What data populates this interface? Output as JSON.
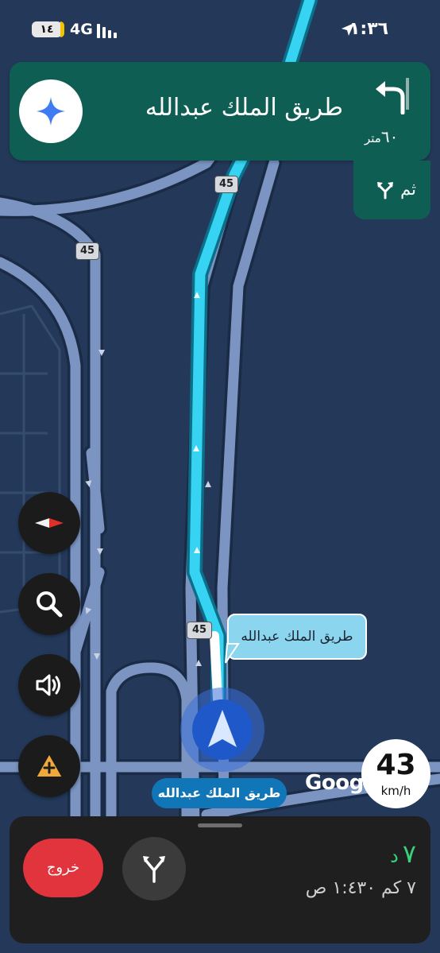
{
  "status_bar": {
    "battery": "١٤",
    "network": "4G",
    "time": "١:٣٦"
  },
  "direction": {
    "street": "طريق الملك عبدالله",
    "distance_value": "٦٠",
    "distance_unit": "متر",
    "then_label": "ثم"
  },
  "map": {
    "road_shields": [
      "45",
      "45",
      "45"
    ],
    "callout_street": "طريق الملك عبدالله",
    "current_road": "طريق الملك عبدالله",
    "attribution": "Google"
  },
  "speed": {
    "value": "43",
    "unit": "km/h"
  },
  "trip": {
    "exit_label": "خروج",
    "eta_minutes": "٧",
    "eta_minutes_unit": "د",
    "summary": "٧ كم  ١:٤٣٠ ص"
  },
  "colors": {
    "map_background": "#24395a",
    "nav_card": "#0f5e53",
    "route": "#36d4f2",
    "exit_button": "#e1343c",
    "eta_green": "#39d27a"
  },
  "icons": {
    "assistant": "sparkle-icon",
    "turn": "turn-left-icon",
    "then": "fork-icon",
    "compass": "compass-icon",
    "search": "search-icon",
    "sound": "speaker-icon",
    "report": "report-incident-icon",
    "routes": "alternate-routes-icon",
    "position": "navigation-arrow-icon"
  }
}
